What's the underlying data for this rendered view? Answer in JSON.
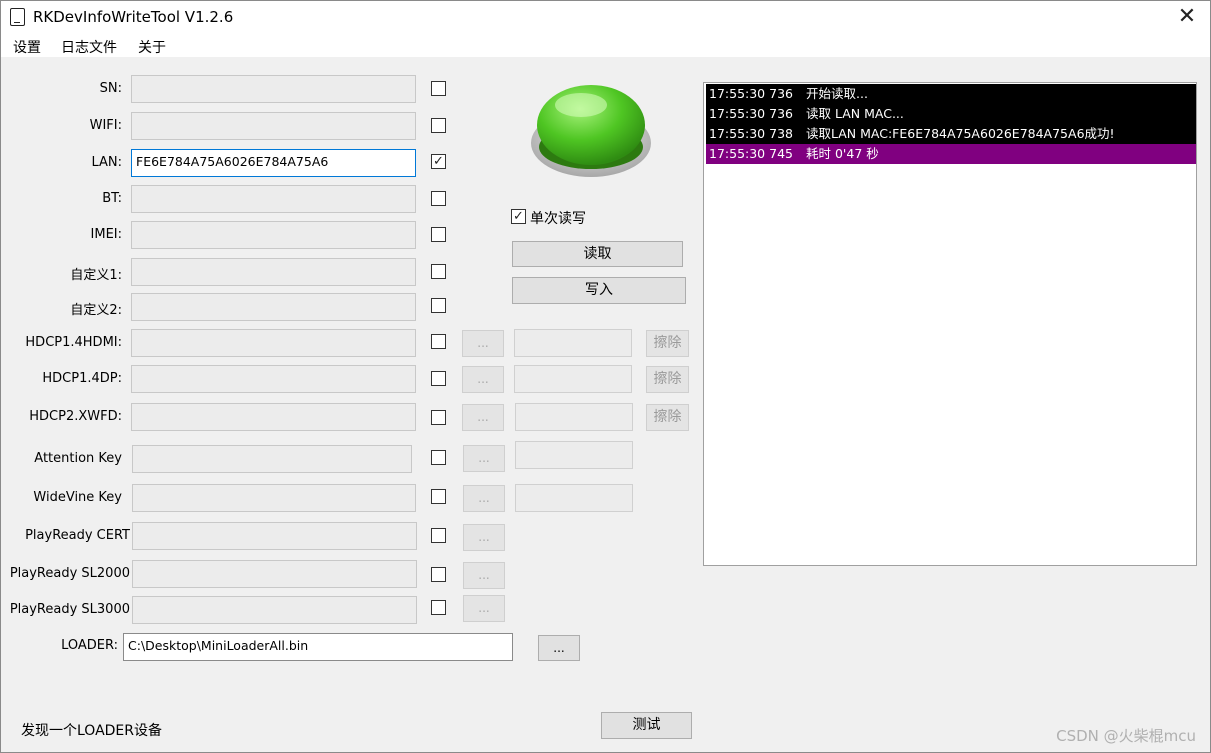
{
  "window": {
    "title": "RKDevInfoWriteTool V1.2.6",
    "close_glyph": "✕"
  },
  "menu": [
    "设置",
    "日志文件",
    "关于"
  ],
  "fields": [
    {
      "label": "SN:",
      "value": "",
      "checked": false
    },
    {
      "label": "WIFI:",
      "value": "",
      "checked": false
    },
    {
      "label": "LAN:",
      "value": "FE6E784A75A6026E784A75A6",
      "checked": true
    },
    {
      "label": "BT:",
      "value": "",
      "checked": false
    },
    {
      "label": "IMEI:",
      "value": "",
      "checked": false
    },
    {
      "label": "自定义1:",
      "value": "",
      "checked": false
    },
    {
      "label": "自定义2:",
      "value": "",
      "checked": false
    },
    {
      "label": "HDCP1.4HDMI:",
      "value": "",
      "checked": false
    },
    {
      "label": "HDCP1.4DP:",
      "value": "",
      "checked": false
    },
    {
      "label": "HDCP2.XWFD:",
      "value": "",
      "checked": false
    },
    {
      "label": "Attention Key",
      "value": "",
      "checked": false
    },
    {
      "label": "WideVine Key",
      "value": "",
      "checked": false
    },
    {
      "label": "PlayReady CERT",
      "value": "",
      "checked": false
    },
    {
      "label": "PlayReady SL2000",
      "value": "",
      "checked": false
    },
    {
      "label": "PlayReady SL3000",
      "value": "",
      "checked": false
    }
  ],
  "browse_label": "...",
  "erase_label": "擦除",
  "loader": {
    "label": "LOADER:",
    "value": "C:\\Desktop\\MiniLoaderAll.bin",
    "browse_label": "..."
  },
  "controls": {
    "single_rw_label": "单次读写",
    "single_rw_checked": true,
    "read_label": "读取",
    "write_label": "写入",
    "test_label": "测试",
    "green_button_color": "#4fc623"
  },
  "log": [
    {
      "time": "17:55:30 736",
      "msg": "开始读取...",
      "bg": "#000000",
      "fg": "#ffffff"
    },
    {
      "time": "17:55:30 736",
      "msg": "读取 LAN MAC...",
      "bg": "#000000",
      "fg": "#ffffff"
    },
    {
      "time": "17:55:30 738",
      "msg": "读取LAN MAC:FE6E784A75A6026E784A75A6成功!",
      "bg": "#000000",
      "fg": "#ffffff"
    },
    {
      "time": "17:55:30 745",
      "msg": "耗时 0'47 秒",
      "bg": "#800080",
      "fg": "#ffffff"
    }
  ],
  "status": "发现一个LOADER设备",
  "watermark": "CSDN @火柴棍mcu"
}
